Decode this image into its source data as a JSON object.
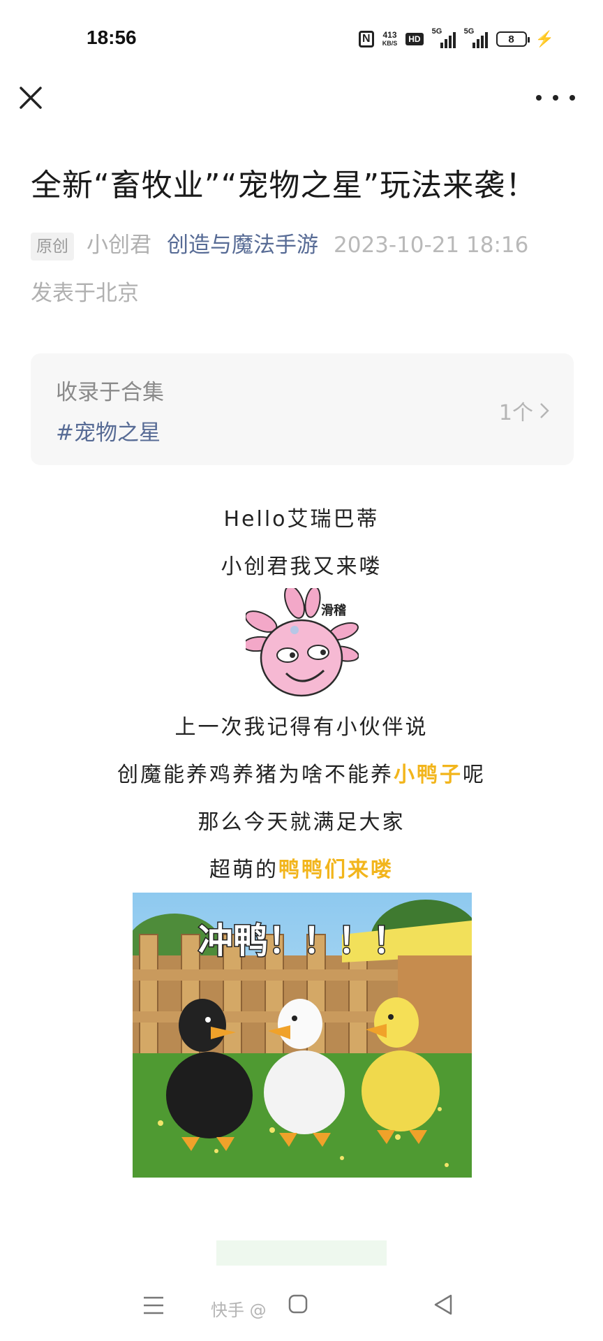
{
  "status_bar": {
    "time": "18:56",
    "net_speed_value": "413",
    "net_speed_unit": "KB/S",
    "hd_label": "HD",
    "signal1_label": "5G",
    "signal2_label": "5G",
    "battery_level": "8"
  },
  "nav": {
    "close_icon": "close-icon",
    "more_icon": "more-icon"
  },
  "article": {
    "title": "全新“畜牧业”“宠物之星”玩法来袭！",
    "original_tag": "原创",
    "author": "小创君",
    "account": "创造与魔法手游",
    "date": "2023-10-21 18:16",
    "location": "发表于北京"
  },
  "collection": {
    "label": "收录于合集",
    "tag": "#宠物之星",
    "count": "1个"
  },
  "body": {
    "line1": "Hello艾瑞巴蒂",
    "line2": "小创君我又来喽",
    "sticker_text": "滑稽",
    "line3": "上一次我记得有小伙伴说",
    "line4_pre": "创魔能养鸡养猪为啥不能养",
    "line4_hl": "小鸭子",
    "line4_post": "呢",
    "line5": "那么今天就满足大家",
    "line6_pre": "超萌的",
    "line6_hl": "鸭鸭们来喽",
    "image_caption": "冲鸭！！！！"
  },
  "bottom_nav": {
    "watermark": "快手 @"
  },
  "colors": {
    "link": "#576b95",
    "highlight": "#f2b51c",
    "meta_gray": "#b0b0b0"
  }
}
